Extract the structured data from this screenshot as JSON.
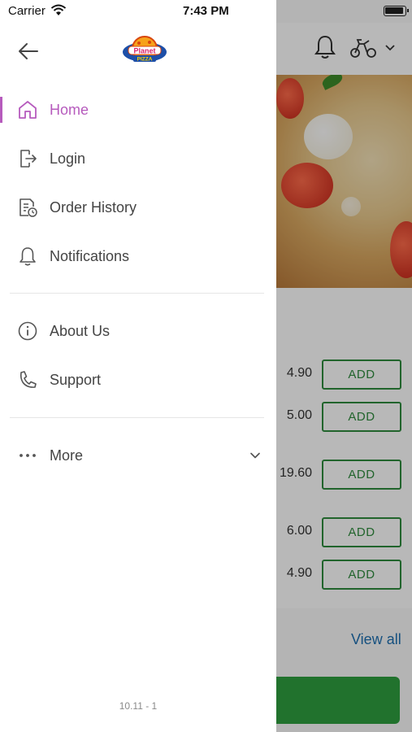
{
  "status_bar": {
    "carrier": "Carrier",
    "time": "7:43 PM"
  },
  "drawer": {
    "logo": {
      "line1": "Planet",
      "line2": "PIZZA"
    },
    "primary_items": [
      {
        "label": "Home",
        "icon": "home-icon",
        "active": true
      },
      {
        "label": "Login",
        "icon": "login-icon",
        "active": false
      },
      {
        "label": "Order History",
        "icon": "order-history-icon",
        "active": false
      },
      {
        "label": "Notifications",
        "icon": "bell-icon",
        "active": false
      }
    ],
    "secondary_items": [
      {
        "label": "About Us",
        "icon": "info-icon"
      },
      {
        "label": "Support",
        "icon": "phone-icon"
      }
    ],
    "more": {
      "label": "More",
      "icon": "more-dots-icon"
    },
    "version": "10.11 - 1",
    "accent_color": "#b65bbd"
  },
  "background": {
    "items": [
      {
        "price": "4.90",
        "button": "ADD"
      },
      {
        "price": "5.00",
        "button": "ADD"
      },
      {
        "price": "19.60",
        "button": "ADD"
      },
      {
        "price": "6.00",
        "button": "ADD"
      },
      {
        "price": "4.90",
        "button": "ADD"
      }
    ],
    "view_all": "View all",
    "button_color": "#2e8b3d"
  }
}
